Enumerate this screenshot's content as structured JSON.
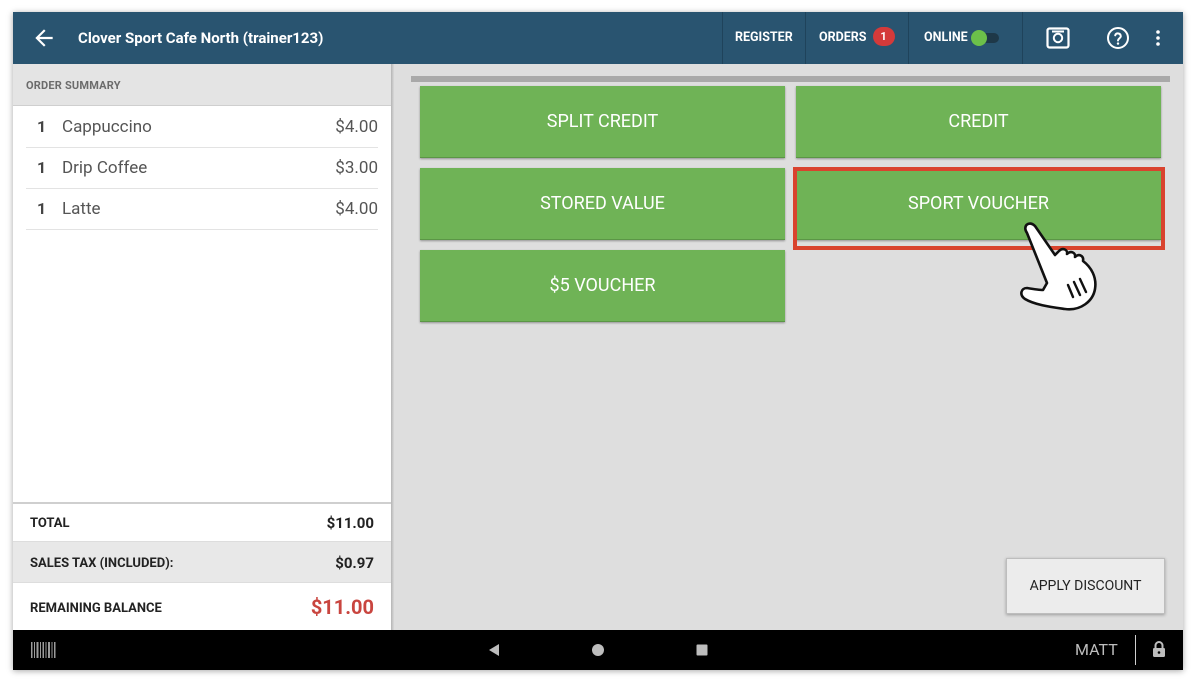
{
  "header": {
    "title": "Clover Sport Cafe North (trainer123)",
    "register_label": "REGISTER",
    "orders_label": "ORDERS",
    "orders_count": "1",
    "online_label": "ONLINE",
    "online_enabled": true,
    "icons": [
      "back-arrow-icon",
      "cash-drawer-icon",
      "help-icon",
      "more-vert-icon"
    ]
  },
  "order_summary": {
    "heading": "ORDER SUMMARY",
    "items": [
      {
        "qty": "1",
        "name": "Cappuccino",
        "price": "$4.00"
      },
      {
        "qty": "1",
        "name": "Drip Coffee",
        "price": "$3.00"
      },
      {
        "qty": "1",
        "name": "Latte",
        "price": "$4.00"
      }
    ],
    "total_label": "TOTAL",
    "total_value": "$11.00",
    "tax_label": "SALES TAX (INCLUDED):",
    "tax_value": "$0.97",
    "remaining_label": "REMAINING BALANCE",
    "remaining_value": "$11.00"
  },
  "tenders": [
    {
      "label": "SPLIT CREDIT"
    },
    {
      "label": "CREDIT"
    },
    {
      "label": "STORED VALUE"
    },
    {
      "label": "SPORT VOUCHER",
      "highlighted": true
    },
    {
      "label": "$5 VOUCHER"
    }
  ],
  "apply_discount_label": "APPLY DISCOUNT",
  "navbar": {
    "user": "MATT",
    "icons": [
      "barcode-icon",
      "back-triangle-icon",
      "home-circle-icon",
      "recents-square-icon",
      "lock-icon"
    ]
  },
  "colors": {
    "header_bg": "#295470",
    "tender_green": "#6fb356",
    "badge_red": "#d43a3a",
    "balance_red": "#c9453f",
    "highlight_red": "#d9432e"
  }
}
